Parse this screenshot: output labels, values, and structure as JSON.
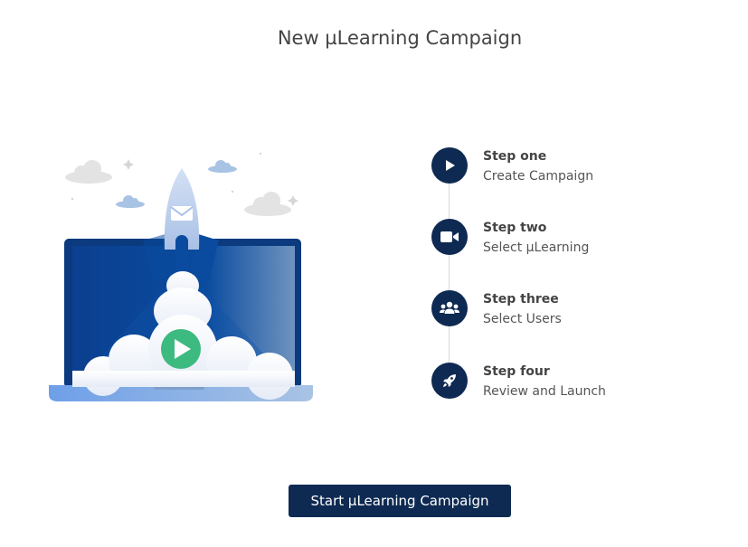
{
  "header": {
    "title": "New µLearning Campaign"
  },
  "steps": [
    {
      "title": "Step one",
      "subtitle": "Create Campaign",
      "icon": "play-icon"
    },
    {
      "title": "Step two",
      "subtitle": "Select µLearning",
      "icon": "video-camera-icon"
    },
    {
      "title": "Step three",
      "subtitle": "Select Users",
      "icon": "users-icon"
    },
    {
      "title": "Step four",
      "subtitle": "Review and Launch",
      "icon": "rocket-icon"
    }
  ],
  "actions": {
    "start_label": "Start µLearning Campaign"
  },
  "colors": {
    "primary": "#0e2a52",
    "laptop_blue": "#0a4b9f",
    "play_green": "#3dba7f",
    "cloud_light": "#e9eef7"
  }
}
